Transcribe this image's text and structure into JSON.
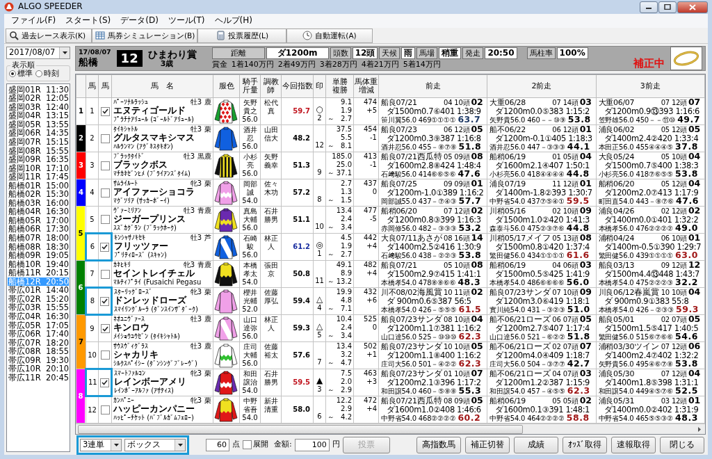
{
  "window": {
    "title": "ALGO SPEEDER"
  },
  "menu": [
    "ファイル(F)",
    "スタート(S)",
    "データ(D)",
    "ツール(T)",
    "ヘルプ(H)"
  ],
  "toolbar": [
    {
      "label": "過去レース表示(K)",
      "kind": "search"
    },
    {
      "label": "馬券シミュレーション(B)",
      "kind": "table"
    },
    {
      "label": "投票履歴(L)",
      "kind": "calculator"
    },
    {
      "label": "自動運転(A)",
      "kind": "clock"
    }
  ],
  "sidebar": {
    "date": "2017/08/07",
    "order_label": "表示順",
    "order_options": [
      {
        "label": "標準",
        "selected": true
      },
      {
        "label": "時刻",
        "selected": false
      }
    ],
    "races": [
      {
        "name": "盛岡01R",
        "time": "11:30",
        "selected": false
      },
      {
        "name": "盛岡02R",
        "time": "12:05",
        "selected": false
      },
      {
        "name": "盛岡03R",
        "time": "12:40",
        "selected": false
      },
      {
        "name": "盛岡04R",
        "time": "13:15",
        "selected": false
      },
      {
        "name": "盛岡05R",
        "time": "13:55",
        "selected": false
      },
      {
        "name": "盛岡06R",
        "time": "14:35",
        "selected": false
      },
      {
        "name": "盛岡07R",
        "time": "15:15",
        "selected": false
      },
      {
        "name": "盛岡08R",
        "time": "15:55",
        "selected": false
      },
      {
        "name": "盛岡09R",
        "time": "16:35",
        "selected": false
      },
      {
        "name": "盛岡10R",
        "time": "17:10",
        "selected": false
      },
      {
        "name": "盛岡11R",
        "time": "17:45",
        "selected": false
      },
      {
        "name": "船橋01R",
        "time": "15:00",
        "selected": false
      },
      {
        "name": "船橋02R",
        "time": "15:30",
        "selected": false
      },
      {
        "name": "船橋03R",
        "time": "16:00",
        "selected": false
      },
      {
        "name": "船橋04R",
        "time": "16:30",
        "selected": false
      },
      {
        "name": "船橋05R",
        "time": "17:00",
        "selected": false
      },
      {
        "name": "船橋06R",
        "time": "17:30",
        "selected": false
      },
      {
        "name": "船橋07R",
        "time": "18:00",
        "selected": false
      },
      {
        "name": "船橋08R",
        "time": "18:30",
        "selected": false
      },
      {
        "name": "船橋09R",
        "time": "19:05",
        "selected": false
      },
      {
        "name": "船橋10R",
        "time": "19:40",
        "selected": false
      },
      {
        "name": "船橋11R",
        "time": "20:15",
        "selected": false
      },
      {
        "name": "船橋12R",
        "time": "20:50",
        "selected": true
      },
      {
        "name": "帯広01R",
        "time": "14:40",
        "selected": false
      },
      {
        "name": "帯広02R",
        "time": "15:20",
        "selected": false
      },
      {
        "name": "帯広03R",
        "time": "15:55",
        "selected": false
      },
      {
        "name": "帯広04R",
        "time": "16:30",
        "selected": false
      },
      {
        "name": "帯広05R",
        "time": "17:05",
        "selected": false
      },
      {
        "name": "帯広06R",
        "time": "17:40",
        "selected": false
      },
      {
        "name": "帯広07R",
        "time": "18:20",
        "selected": false
      },
      {
        "name": "帯広08R",
        "time": "18:55",
        "selected": false
      },
      {
        "name": "帯広09R",
        "time": "19:30",
        "selected": false
      },
      {
        "name": "帯広10R",
        "time": "20:10",
        "selected": false
      },
      {
        "name": "帯広11R",
        "time": "20:45",
        "selected": false
      }
    ]
  },
  "race": {
    "date": "17/08/07",
    "venue": "船橋",
    "number": "12",
    "name": "ひまわり賞",
    "condition": "3歳",
    "info": [
      {
        "label": "距離",
        "value": "ダ1200m"
      },
      {
        "label": "頭数",
        "value": "12頭"
      },
      {
        "label": "天候",
        "value": "雨"
      },
      {
        "label": "馬場",
        "value": "稍重"
      },
      {
        "label": "発走",
        "value": "20:50"
      },
      {
        "label": "馬柱率",
        "value": "100%"
      }
    ],
    "prize_label": "賞金",
    "prizes": [
      "1着140万円",
      "2着49万円",
      "3着28万円",
      "4着21万円",
      "5着14万円"
    ],
    "status": "補正中"
  },
  "table": {
    "columns": [
      "馬",
      "馬",
      "馬　名",
      "服色",
      "騎手斤量",
      "調教師",
      "今回指数",
      "印",
      "単勝複勝",
      "馬体重増減",
      "前走",
      "2前走",
      "3前走"
    ],
    "frames": [
      {
        "label": "1",
        "color": "#ffffff",
        "horses": [
          {
            "number": "1",
            "checked": true,
            "highlighted": false,
            "sire": "ﾊﾟｰｿﾅﾙﾗｯｼｭ",
            "sex_age": "牡3",
            "coat": "鹿",
            "name": "エヌティゴールド",
            "dam": "ﾌﾟﾗﾁﾅｱﾘｭｰﾙ (ｺﾞｰﾙﾄﾞｱﾘｭｰﾙ)",
            "silks": [
              {
                "kind": "body",
                "color": "#ffffff"
              },
              {
                "kind": "diamonds",
                "color": "#e01818"
              },
              {
                "kind": "sleeves",
                "color": "#18a030"
              }
            ],
            "jockey": "矢野貴之",
            "carried": "56.0",
            "trainer": "松代真",
            "index": {
              "text": "59.7",
              "color": "#c0141e"
            },
            "mark": "○",
            "popularity": "2",
            "odds": [
              "9.1",
              "1.9",
              "～",
              "2.7"
            ],
            "body_weight": "474",
            "change": "+5",
            "prev": [
              {
                "date": "船良07/21",
                "gate_field": "04 10頭",
                "place": "02",
                "course": "ダ1500m0.7⑥401 1:38:9",
                "jockey_line": "笹川翼56.0 469①①①①",
                "score": {
                  "text": "63.7",
                  "color": "#1f3a66"
                }
              },
              {
                "date": "大重06/28",
                "gate_field": "07 14頭",
                "place": "03",
                "course": "ダ1200m0.0⑤383 1:15:2",
                "jockey_line": "矢野貴56.0 460－－⑩⑨",
                "score": {
                  "text": "53.8",
                  "color": "#000000"
                }
              },
              {
                "date": "大重06/07",
                "gate_field": "07 12頭",
                "place": "07",
                "course": "ダ1200m0.9⑬393 1:16:6",
                "jockey_line": "笠野雄56.0 450－－⑪⑩",
                "score": {
                  "text": "49.7",
                  "color": "#000000"
                }
              }
            ]
          }
        ]
      },
      {
        "label": "2",
        "color": "#000000",
        "horses": [
          {
            "number": "2",
            "checked": false,
            "highlighted": false,
            "sire": "ﾀｲｷｼｬﾄﾙ",
            "sex_age": "牡3",
            "coat": "栗",
            "name": "グルタスマキシマス",
            "dam": "ﾊﾙﾗﾝﾏﾝ (ｱｸﾞﾈｽﾀｷｵﾝ)",
            "silks": [
              {
                "kind": "body",
                "color": "#1060e0"
              }
            ],
            "jockey": "酒井忍",
            "carried": "56.0",
            "trainer": "山田信大",
            "index": {
              "text": "48.2",
              "color": "#000000"
            },
            "popularity": "12",
            "odds": [
              "37.5",
              "5.5",
              "～",
              "8.1"
            ],
            "body_weight": "454",
            "change": "-1",
            "prev": [
              {
                "date": "船良07/23",
                "gate_field": "06 12頭",
                "place": "05",
                "course": "ダ1200m0.3⑨387 1:16:8",
                "jockey_line": "酒井忍56.0 455－⑧⑦⑧",
                "score": {
                  "text": "51.8",
                  "color": "#000000"
                }
              },
              {
                "date": "船不06/22",
                "gate_field": "06 12頭",
                "place": "01",
                "course": "ダ1200m-0.1①405 1:18:3",
                "jockey_line": "酒井忍56.0 447－③③③",
                "score": {
                  "text": "44.1",
                  "color": "#000000"
                }
              },
              {
                "date": "浦良06/02",
                "gate_field": "05 12頭",
                "place": "05",
                "course": "ダ1400m2.4②420 1:33:4",
                "jockey_line": "本田正56.0 455④④④⑤",
                "score": {
                  "text": "37.8",
                  "color": "#000000"
                }
              }
            ]
          }
        ]
      },
      {
        "label": "3",
        "color": "#ff0000",
        "horses": [
          {
            "number": "3",
            "checked": false,
            "highlighted": false,
            "sire": "ﾌﾞﾗｯｸﾀｲﾄﾞ",
            "sex_age": "牡3",
            "coat": "黒鹿",
            "name": "ブラックボス",
            "dam": "ﾏﾁｶﾈｾﾞﾝﾋﾒ (ﾌﾞﾗｲｱﾝｽﾞﾀｲﾑ)",
            "silks": [
              {
                "kind": "body",
                "color": "#f0e020"
              },
              {
                "kind": "stripes",
                "color": "#101010"
              },
              {
                "kind": "sleeves",
                "color": "#101010"
              }
            ],
            "jockey": "小杉亮",
            "carried": "56.0",
            "trainer": "矢野義幸",
            "index": {
              "text": "51.3",
              "color": "#000000"
            },
            "popularity": "9",
            "odds": [
              "185.0",
              "25.0",
              "～",
              "37.1"
            ],
            "body_weight": "413",
            "change": "-1",
            "prev": [
              {
                "date": "船良07/21",
                "race": "西瓜特",
                "gate_field": "05 09頭",
                "place": "08",
                "course": "ダ1600m2.8⑧424 1:48:4",
                "jockey_line": "石﨑駿56.0 414⑥⑥⑤⑥",
                "score": {
                  "text": "47.6",
                  "color": "#000000"
                }
              },
              {
                "date": "船稍06/19",
                "gate_field": "01 05頭",
                "place": "04",
                "course": "ダ1600m2.1④407 1:50:1",
                "jockey_line": "小杉亮56.0 418④④④④",
                "score": {
                  "text": "44.8",
                  "color": "#000000"
                }
              },
              {
                "date": "大良05/24",
                "gate_field": "05 10頭",
                "place": "04",
                "course": "ダ1500m0.7⑤400 1:38:3",
                "jockey_line": "小杉亮56.0 418⑦⑥⑤⑤",
                "score": {
                  "text": "53.8",
                  "color": "#000000"
                }
              }
            ]
          }
        ]
      },
      {
        "label": "4",
        "color": "#0000ff",
        "horses": [
          {
            "number": "4",
            "checked": false,
            "highlighted": false,
            "sire": "ｻﾑﾗｲﾙｰﾄ",
            "sex_age": "牝3",
            "coat": "栗",
            "name": "アイファーショコラ",
            "dam": "ﾏｸﾞｿﾘｱ (ｻｯｶｰﾎﾞｰｲ)",
            "silks": [
              {
                "kind": "body",
                "color": "#f0a0e8"
              },
              {
                "kind": "zigzag",
                "color": "#ffffff"
              }
            ],
            "jockey": "岡部誠",
            "carried": "54.0",
            "trainer": "佐々木功",
            "index": {
              "text": "57.2",
              "color": "#000000"
            },
            "popularity": "8",
            "odds": [
              "2.7",
              "1.3",
              "～",
              "1.5"
            ],
            "body_weight": "437",
            "change": "0",
            "prev": [
              {
                "date": "船良07/25",
                "gate_field": "09 09頭",
                "place": "01",
                "course": "ダ1200m-1.0①389 1:16:2",
                "jockey_line": "岡部誠55.0 437－⑦④③",
                "score": {
                  "text": "57.7",
                  "color": "#000000"
                }
              },
              {
                "date": "浦良07/19",
                "gate_field": "11 12頭",
                "place": "01",
                "course": "ダ1400m-1.8②393 1:30:7",
                "jockey_line": "中野省54.0 437⑦⑤④①",
                "score": {
                  "text": "59.5",
                  "color": "#a01818"
                }
              },
              {
                "date": "船稍06/20",
                "gate_field": "05 12頭",
                "place": "04",
                "course": "ダ1200m2.0⑦413 1:17:9",
                "jockey_line": "町田直54.0 443－⑧⑦⑥",
                "score": {
                  "text": "47.6",
                  "color": "#000000"
                }
              }
            ]
          }
        ]
      },
      {
        "label": "5",
        "color": "#ffff00",
        "horses": [
          {
            "number": "5",
            "checked": false,
            "highlighted": false,
            "sire": "ｳﾞｧｰﾐﾘｱﾝ",
            "sex_age": "牡3",
            "coat": "青鹿",
            "name": "ジーガープリンス",
            "dam": "ｽｽﾞｶｸﾞﾗﾝ (ﾌﾞﾗｯｸﾎｰｸ)",
            "silks": [
              {
                "kind": "body",
                "color": "#6a2ab0"
              },
              {
                "kind": "zigzag",
                "color": "#f0e020"
              },
              {
                "kind": "sleeves",
                "color": "#f0e020"
              }
            ],
            "jockey": "真島大輔",
            "carried": "56.0",
            "trainer": "石井勝男",
            "index": {
              "text": "51.1",
              "color": "#000000"
            },
            "popularity": "10",
            "odds": [
              "13.4",
              "2.4",
              "～",
              "3.4"
            ],
            "body_weight": "477",
            "change": "-5",
            "prev": [
              {
                "date": "船稍06/20",
                "gate_field": "07 12頭",
                "place": "02",
                "course": "ダ1200m0.8③399 1:16:3",
                "jockey_line": "赤岡修56.0 482－③③③",
                "score": {
                  "text": "53.2",
                  "color": "#000000"
                }
              },
              {
                "date": "川稍05/16",
                "gate_field": "02 10頭",
                "place": "09",
                "course": "ダ1500m1.0②420 1:41:3",
                "jockey_line": "森泰斗56.0 475②③⑦⑥",
                "score": {
                  "text": "44.8",
                  "color": "#000000"
                }
              },
              {
                "date": "浦良04/26",
                "gate_field": "02 12頭",
                "place": "02",
                "course": "ダ1400m0.0①401 1:32:2",
                "jockey_line": "本橋孝56.0 476②②②②",
                "score": {
                  "text": "49.0",
                  "color": "#000000"
                }
              }
            ]
          },
          {
            "number": "6",
            "checked": true,
            "highlighted": true,
            "sire": "ｷﾝｼｬｻﾉｷｾｷ",
            "sex_age": "牡3",
            "coat": "芦",
            "name": "フリッツァー",
            "dam": "ﾌﾟﾘﾃｨﾛｰｽﾞ (ｽｷｬﾝ)",
            "silks": [
              {
                "kind": "body",
                "color": "#1060e0"
              },
              {
                "kind": "sash",
                "color": "#ffffff"
              }
            ],
            "jockey": "石崎駿",
            "carried": "56.0",
            "trainer": "林正人",
            "index": {
              "text": "61.2",
              "color": "#1a2ea0"
            },
            "mark": "◎",
            "popularity": "1",
            "odds": [
              "4.5",
              "1.9",
              "～",
              "2.7"
            ],
            "body_weight": "442",
            "change": "+4",
            "prev": [
              {
                "date": "大良07/11",
                "race": "あさが",
                "gate_field": "08 16頭",
                "place": "14",
                "course": "ダ1400m2.5②416 1:30:9",
                "jockey_line": "石﨑駿56.0 438－②②③",
                "score": {
                  "text": "53.8",
                  "color": "#000000"
                }
              },
              {
                "date": "川稍05/17",
                "race": "メイフ",
                "gate_field": "05 13頭",
                "place": "08",
                "course": "ダ1500m0.8①420 1:37:4",
                "jockey_line": "繁田健56.0 434①①①①",
                "score": {
                  "text": "61.6",
                  "color": "#a01818"
                }
              },
              {
                "date": "浦稍04/24",
                "gate_field": "06 10頭",
                "place": "01",
                "course": "ダ1400m-0.5①390 1:29:7",
                "jockey_line": "繁田健56.0 439①①①①",
                "score": {
                  "text": "63.0",
                  "color": "#a01818"
                }
              }
            ]
          }
        ]
      },
      {
        "label": "6",
        "color": "#008000",
        "horses": [
          {
            "number": "7",
            "checked": false,
            "highlighted": false,
            "sire": "ｶﾈﾋｷﾘ",
            "sex_age": "牝3",
            "coat": "青鹿",
            "name": "セイントレイチェル",
            "dam": "ﾏﾙﾃｨﾌﾟﾗｲ (Fusaichi Pegasu",
            "silks": [
              {
                "kind": "body",
                "color": "#f0e020"
              },
              {
                "kind": "halves",
                "color": "#101010"
              },
              {
                "kind": "sleeves",
                "color": "#101010"
              }
            ],
            "jockey": "本橋孝太",
            "carried": "54.0",
            "trainer": "張田京",
            "index": {
              "text": "50.8",
              "color": "#000000"
            },
            "popularity": "11",
            "odds": [
              "49.1",
              "8.9",
              "～",
              "13.2"
            ],
            "body_weight": "482",
            "change": "+4",
            "prev": [
              {
                "date": "船良07/21",
                "gate_field": "05 10頭",
                "place": "08",
                "course": "ダ1500m2.9⑦415 1:41:1",
                "jockey_line": "本橋孝54.0 478⑧⑧⑥⑥",
                "score": {
                  "text": "48.3",
                  "color": "#000000"
                }
              },
              {
                "date": "船稍06/19",
                "gate_field": "04 06頭",
                "place": "03",
                "course": "ダ1500m0.5⑤425 1:41:9",
                "jockey_line": "本橋孝54.0 486⑥⑥⑥⑥",
                "score": {
                  "text": "56.0",
                  "color": "#000000"
                }
              },
              {
                "date": "船良03/13",
                "gate_field": "09 12頭",
                "place": "12",
                "course": "ダ1500m4.4⑬448 1:43:7",
                "jockey_line": "本橋孝54.0 475②②②③",
                "score": {
                  "text": "32.2",
                  "color": "#000000"
                }
              }
            ]
          },
          {
            "number": "8",
            "checked": true,
            "highlighted": true,
            "sire": "ｽﾀｰﾘｯｸﾞﾛｰｽﾞ",
            "sex_age": "牝3",
            "coat": "栗",
            "name": "ドンレッドローズ",
            "dam": "ｽﾏｲﾘﾝｸﾞﾙｰﾗ (ﾀﾞﾝｽｲﾝｻﾞﾀﾞｰｸ)",
            "silks": [
              {
                "kind": "body",
                "color": "#f0a0e8"
              }
            ],
            "jockey": "櫻井光輔",
            "carried": "52.0",
            "trainer": "佐藤厚弘",
            "index": {
              "text": "59.4",
              "color": "#000000"
            },
            "mark": "△",
            "popularity": "4",
            "odds": [
              "19.9",
              "4.8",
              "～",
              "7.1"
            ],
            "body_weight": "432",
            "change": "+6",
            "prev": [
              {
                "date": "川不08/02",
                "race": "海風賞",
                "gate_field": "10 11頭",
                "place": "02",
                "course": "ダ 900m0.6⑤387 56:5",
                "jockey_line": "本橋孝54.0 426－⑤⑤⑤",
                "score": {
                  "text": "61.5",
                  "color": "#a01818"
                }
              },
              {
                "date": "船良07/23",
                "race": "サンダ",
                "gate_field": "07 10頭",
                "place": "09",
                "course": "ダ1200m3.0⑥419 1:18:1",
                "jockey_line": "實川純54.0 431－③②③",
                "score": {
                  "text": "51.0",
                  "color": "#000000"
                }
              },
              {
                "date": "川良06/12",
                "race": "春嵐賞",
                "gate_field": "10 10頭",
                "place": "04",
                "course": "ダ 900m0.9①383 55:8",
                "jockey_line": "本橋孝54.0 426－②③③",
                "score": {
                  "text": "59.3",
                  "color": "#a01818"
                }
              }
            ]
          }
        ]
      },
      {
        "label": "7",
        "color": "#ff9900",
        "horses": [
          {
            "number": "9",
            "checked": true,
            "highlighted": false,
            "sire": "ﾈｵﾕﾆｳﾞｧｰｽ",
            "sex_age": "牡3",
            "coat": "鹿",
            "name": "キンロウ",
            "dam": "ﾒｲｼｮｳﾕｳｾﾞﾝ (ﾀｲｷｼｬﾄﾙ)",
            "silks": [
              {
                "kind": "body",
                "color": "#f0a0e8"
              },
              {
                "kind": "sash",
                "color": "#ffffff"
              }
            ],
            "jockey": "山口達弥",
            "carried": "56.0",
            "trainer": "林正人",
            "index": {
              "text": "59.3",
              "color": "#000000"
            },
            "mark": "△",
            "popularity": "5",
            "odds": [
              "10.4",
              "2.4",
              "～",
              "3.4"
            ],
            "body_weight": "525",
            "change": "0",
            "prev": [
              {
                "date": "船良07/23",
                "race": "サンダ",
                "gate_field": "08 10頭",
                "place": "04",
                "course": "ダ1200m1.1⑦381 1:16:2",
                "jockey_line": "山口達56.0 525－⑩⑩⑩",
                "score": {
                  "text": "62.3",
                  "color": "#a01818"
                }
              },
              {
                "date": "船不06/21",
                "race": "ローズ",
                "gate_field": "06 07頭",
                "place": "05",
                "course": "ダ1200m2.7⑤407 1:17:4",
                "jockey_line": "山口達56.0 521－⑥②②",
                "score": {
                  "text": "51.8",
                  "color": "#000000"
                }
              },
              {
                "date": "船良05/01",
                "gate_field": "02 07頭",
                "place": "05",
                "course": "ダ1500m1.5⑤417 1:40:5",
                "jockey_line": "繁田健56.0 515⑥⑦⑥⑥",
                "score": {
                  "text": "54.6",
                  "color": "#000000"
                }
              }
            ]
          },
          {
            "number": "10",
            "checked": false,
            "highlighted": false,
            "sire": "ｻｳｽｳﾞｨｸﾞﾗｽ",
            "sex_age": "牡3",
            "coat": "鹿",
            "name": "シャカリキ",
            "dam": "ｼﾙｸｽﾊﾟｲｼｰ (ﾀﾞﾝｼﾝｸﾞﾌﾞﾚｰｳﾞ)",
            "silks": [
              {
                "kind": "body",
                "color": "#ffffff"
              },
              {
                "kind": "zigzag",
                "color": "#30c030"
              }
            ],
            "jockey": "庄司大輔",
            "carried": "56.0",
            "trainer": "佐藤裕太",
            "index": {
              "text": "57.6",
              "color": "#000000"
            },
            "popularity": "7",
            "odds": [
              "13.4",
              "3.2",
              "～",
              "4.7"
            ],
            "body_weight": "502",
            "change": "+1",
            "prev": [
              {
                "date": "船良07/23",
                "race": "サンダ",
                "gate_field": "10 10頭",
                "place": "05",
                "course": "ダ1200m1.1⑧400 1:16:2",
                "jockey_line": "庄司大56.0 501－④②②",
                "score": {
                  "text": "62.3",
                  "color": "#a01818"
                }
              },
              {
                "date": "船不06/21",
                "race": "ローズ",
                "gate_field": "02 07頭",
                "place": "07",
                "course": "ダ1200m4.0④409 1:18:7",
                "jockey_line": "庄司大56.0 504－③⑦⑦",
                "score": {
                  "text": "42.7",
                  "color": "#000000"
                }
              },
              {
                "date": "浦稍03/30",
                "race": "ツイン",
                "gate_field": "07 12頭",
                "place": "06",
                "course": "ダ1400m2.4⑦402 1:32:2",
                "jockey_line": "矢野貴56.0 495④⑥⑦⑧",
                "score": {
                  "text": "53.8",
                  "color": "#000000"
                }
              }
            ]
          }
        ]
      },
      {
        "label": "8",
        "color": "#ff00ff",
        "horses": [
          {
            "number": "11",
            "checked": true,
            "highlighted": true,
            "sire": "ｽﾏｰﾄﾌｧﾙｺﾝ",
            "sex_age": "牝3",
            "coat": "栗",
            "name": "レインボーアメリ",
            "dam": "ﾚｲﾝﾎﾞｰｱﾙﾌｧ (ｱｻﾃｨｽ)",
            "silks": [
              {
                "kind": "body",
                "color": "#e01818"
              },
              {
                "kind": "zigzag",
                "color": "#ffffff"
              },
              {
                "kind": "sleeves",
                "color": "#6a2ab0"
              }
            ],
            "jockey": "和田譲治",
            "carried": "54.0",
            "trainer": "石井勝男",
            "index": {
              "text": "59.5",
              "color": "#c0141e"
            },
            "mark": "▲",
            "popularity": "3",
            "odds": [
              "7.5",
              "2.0",
              "～",
              "2.9"
            ],
            "body_weight": "463",
            "change": "+3",
            "prev": [
              {
                "date": "船良07/23",
                "race": "サンダ",
                "gate_field": "01 10頭",
                "place": "07",
                "course": "ダ1200m2.1③396 1:17:2",
                "jockey_line": "和田譲54.0 460－⑤⑧⑧",
                "score": {
                  "text": "55.3",
                  "color": "#000000"
                }
              },
              {
                "date": "船不06/21",
                "race": "ローズ",
                "gate_field": "04 07頭",
                "place": "03",
                "course": "ダ1200m1.2②387 1:15:9",
                "jockey_line": "和田譲54.0 457－④⑤⑤",
                "score": {
                  "text": "62.3",
                  "color": "#a01818"
                }
              },
              {
                "date": "浦良05/30",
                "gate_field": "07 12頭",
                "place": "04",
                "course": "ダ1400m1.8⑤398 1:31:1",
                "jockey_line": "和田譲54.0 449④⑤⑦⑥",
                "score": {
                  "text": "52.5",
                  "color": "#000000"
                }
              }
            ]
          },
          {
            "number": "12",
            "checked": false,
            "highlighted": false,
            "sire": "ｶﾝﾊﾟﾆｰ",
            "sex_age": "牝3",
            "coat": "栗",
            "name": "ハッピーカンパニー",
            "dam": "ﾊｯﾋﾟｰﾁｹｯﾄ (ﾊﾞﾌﾞﾙｶﾞﾑﾌｪﾛｰ)",
            "silks": [
              {
                "kind": "body",
                "color": "#f0e020"
              },
              {
                "kind": "halves",
                "color": "#e01818"
              },
              {
                "kind": "sleeves",
                "color": "#e01818"
              }
            ],
            "jockey": "中野省吾",
            "carried": "54.0",
            "trainer": "新井清重",
            "index": {
              "text": "58.0",
              "color": "#000000"
            },
            "popularity": "6",
            "odds": [
              "12.2",
              "2.9",
              "～",
              "4.2"
            ],
            "body_weight": "472",
            "change": "+4",
            "prev": [
              {
                "date": "船良07/21",
                "race": "西瓜特",
                "gate_field": "08 09頭",
                "place": "05",
                "course": "ダ1600m1.0②408 1:46:6",
                "jockey_line": "中野省54.0 468②②②②",
                "score": {
                  "text": "60.2",
                  "color": "#a01818"
                }
              },
              {
                "date": "船稍06/19",
                "gate_field": "05 05頭",
                "place": "02",
                "course": "ダ1600m0.1③391 1:48:1",
                "jockey_line": "中野省54.0 464②②②②",
                "score": {
                  "text": "58.8",
                  "color": "#a01818"
                }
              },
              {
                "date": "浦良05/31",
                "gate_field": "03 12頭",
                "place": "01",
                "course": "ダ1400m0.0②402 1:31:9",
                "jockey_line": "中野省54.0 465⑤⑤③②",
                "score": {
                  "text": "48.3",
                  "color": "#000000"
                }
              }
            ]
          }
        ]
      }
    ]
  },
  "footer": {
    "highlighted": true,
    "bet_type": "3連単",
    "bet_method": "ボックス",
    "points": "60",
    "points_unit": "点",
    "expand": {
      "label": "展開",
      "checked": false
    },
    "amount_label": "金額:",
    "amount": "100",
    "yen": "円",
    "vote": {
      "label": "投票",
      "disabled": true
    },
    "buttons": [
      "高指数馬",
      "補正切替",
      "成績",
      "ｵｯｽﾞ取得",
      "速報取得",
      "閉じる"
    ]
  }
}
